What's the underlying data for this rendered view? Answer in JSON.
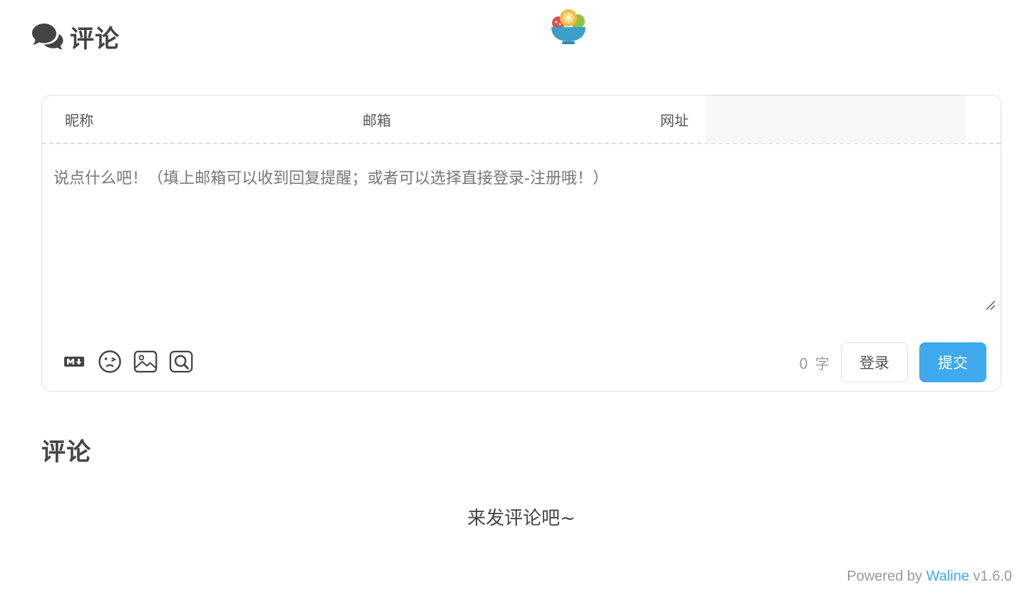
{
  "header": {
    "title": "评论",
    "icon": "comments-icon"
  },
  "logo": {
    "icon": "salad-bowl-logo"
  },
  "form": {
    "nick_label": "昵称",
    "mail_label": "邮箱",
    "link_label": "网址",
    "nick_value": "",
    "mail_value": "",
    "link_value": "",
    "editor_placeholder": "说点什么吧！（填上邮箱可以收到回复提醒；或者可以选择直接登录-注册哦！）",
    "editor_value": "",
    "tools": [
      {
        "name": "markdown-icon"
      },
      {
        "name": "emoji-icon"
      },
      {
        "name": "image-icon"
      },
      {
        "name": "preview-icon"
      }
    ],
    "word_count": "0",
    "word_unit": "字",
    "login_label": "登录",
    "submit_label": "提交"
  },
  "comments": {
    "title": "评论",
    "empty_text": "来发评论吧~"
  },
  "footer": {
    "powered_prefix": "Powered by",
    "brand": "Waline",
    "version": "v1.6.0"
  },
  "colors": {
    "accent": "#3ea9ec",
    "text": "#444444",
    "muted": "#999999",
    "border": "#dddddd"
  }
}
